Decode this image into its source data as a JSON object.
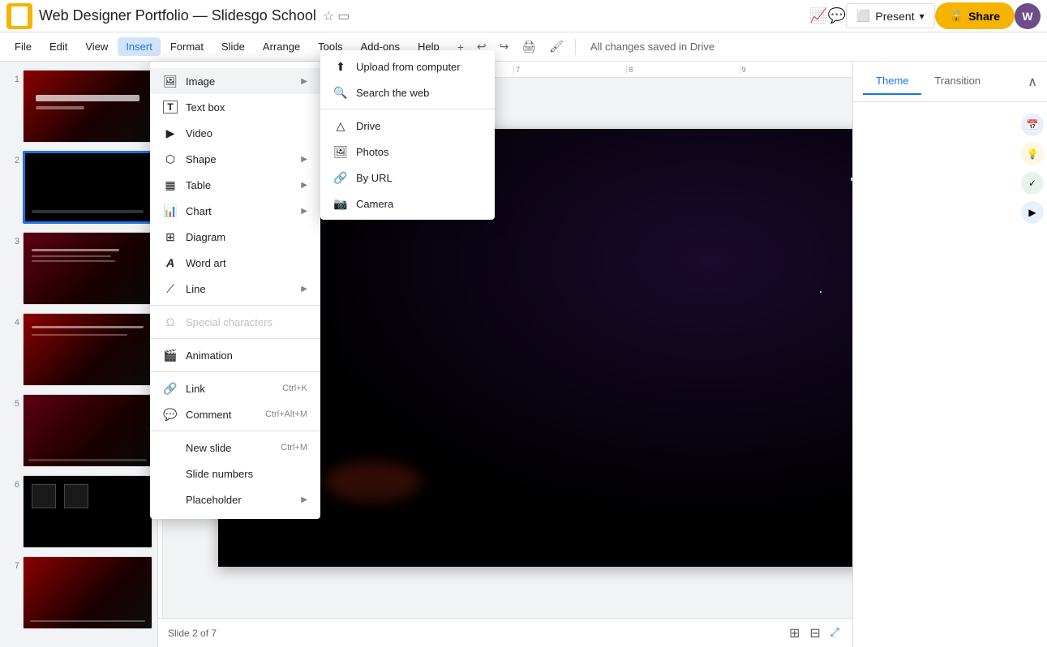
{
  "title_bar": {
    "app_name": "Web Designer Portfolio — Slidesgo School",
    "star_icon": "☆",
    "folder_icon": "▭",
    "autosave": "All changes saved in Drive",
    "present_label": "Present",
    "share_label": "🔒 Share",
    "avatar_letter": "W"
  },
  "menu_bar": {
    "items": [
      {
        "label": "File",
        "active": false
      },
      {
        "label": "Edit",
        "active": false
      },
      {
        "label": "View",
        "active": false
      },
      {
        "label": "Insert",
        "active": true
      },
      {
        "label": "Format",
        "active": false
      },
      {
        "label": "Slide",
        "active": false
      },
      {
        "label": "Arrange",
        "active": false
      },
      {
        "label": "Tools",
        "active": false
      },
      {
        "label": "Add-ons",
        "active": false
      },
      {
        "label": "Help",
        "active": false
      }
    ],
    "autosave": "All changes saved in Drive"
  },
  "insert_menu": {
    "sections": [
      {
        "items": [
          {
            "icon": "🖼",
            "label": "Image",
            "has_arrow": true,
            "disabled": false,
            "shortcut": ""
          },
          {
            "icon": "T",
            "label": "Text box",
            "has_arrow": false,
            "disabled": false,
            "shortcut": ""
          },
          {
            "icon": "▶",
            "label": "Video",
            "has_arrow": false,
            "disabled": false,
            "shortcut": ""
          },
          {
            "icon": "⬡",
            "label": "Shape",
            "has_arrow": true,
            "disabled": false,
            "shortcut": ""
          },
          {
            "icon": "▦",
            "label": "Table",
            "has_arrow": true,
            "disabled": false,
            "shortcut": ""
          },
          {
            "icon": "📊",
            "label": "Chart",
            "has_arrow": true,
            "disabled": false,
            "shortcut": ""
          },
          {
            "icon": "⊞",
            "label": "Diagram",
            "has_arrow": false,
            "disabled": false,
            "shortcut": ""
          },
          {
            "icon": "A",
            "label": "Word art",
            "has_arrow": false,
            "disabled": false,
            "shortcut": ""
          },
          {
            "icon": "⟋",
            "label": "Line",
            "has_arrow": true,
            "disabled": false,
            "shortcut": ""
          }
        ]
      },
      {
        "items": [
          {
            "icon": "Ω",
            "label": "Special characters",
            "has_arrow": false,
            "disabled": true,
            "shortcut": ""
          }
        ]
      },
      {
        "items": [
          {
            "icon": "🎬",
            "label": "Animation",
            "has_arrow": false,
            "disabled": false,
            "shortcut": ""
          }
        ]
      },
      {
        "items": [
          {
            "icon": "🔗",
            "label": "Link",
            "has_arrow": false,
            "disabled": false,
            "shortcut": "Ctrl+K"
          },
          {
            "icon": "💬",
            "label": "Comment",
            "has_arrow": false,
            "disabled": false,
            "shortcut": "Ctrl+Alt+M"
          }
        ]
      },
      {
        "items": [
          {
            "icon": "",
            "label": "New slide",
            "has_arrow": false,
            "disabled": false,
            "shortcut": "Ctrl+M"
          },
          {
            "icon": "",
            "label": "Slide numbers",
            "has_arrow": false,
            "disabled": false,
            "shortcut": ""
          },
          {
            "icon": "",
            "label": "Placeholder",
            "has_arrow": true,
            "disabled": false,
            "shortcut": ""
          }
        ]
      }
    ]
  },
  "image_submenu": {
    "items": [
      {
        "icon": "⬆",
        "label": "Upload from computer",
        "disabled": false
      },
      {
        "icon": "🔍",
        "label": "Search the web",
        "disabled": false
      },
      {
        "icon": "△",
        "label": "Drive",
        "disabled": false
      },
      {
        "icon": "🖼",
        "label": "Photos",
        "disabled": false
      },
      {
        "icon": "🔗",
        "label": "By URL",
        "disabled": false
      },
      {
        "icon": "📷",
        "label": "Camera",
        "disabled": false
      }
    ]
  },
  "slides": [
    {
      "num": "1",
      "bg": "slide-bg-1"
    },
    {
      "num": "2",
      "bg": "slide-bg-2",
      "active": true
    },
    {
      "num": "3",
      "bg": "slide-bg-3"
    },
    {
      "num": "4",
      "bg": "slide-bg-1"
    },
    {
      "num": "5",
      "bg": "slide-bg-3"
    },
    {
      "num": "6",
      "bg": "slide-bg-2"
    },
    {
      "num": "7",
      "bg": "slide-bg-1"
    }
  ],
  "right_panel": {
    "tabs": [
      {
        "label": "Theme",
        "active": true
      },
      {
        "label": "Transition",
        "active": false
      }
    ]
  },
  "bottom_bar": {
    "slide_info": "Slide 2 of 7"
  },
  "colors": {
    "accent": "#1a73e8",
    "active_menu": "#d2e3fc",
    "share_btn": "#f4b400"
  }
}
